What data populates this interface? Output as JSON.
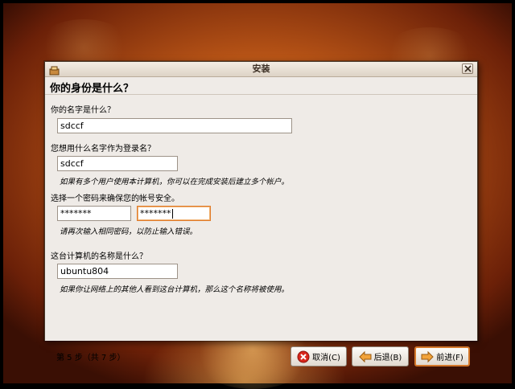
{
  "window": {
    "title": "安装",
    "heading": "你的身份是什么？"
  },
  "form": {
    "name_label": "你的名字是什么？",
    "name_value": "sdccf",
    "login_label": "您想用什么名字作为登录名？",
    "login_value": "sdccf",
    "login_hint": "如果有多个用户使用本计算机，你可以在完成安装后建立多个帐户。",
    "password_label": "选择一个密码来确保您的帐号安全。",
    "password_value": "*******",
    "password_confirm_value": "*******",
    "password_hint": "请再次输入相同密码，以防止输入错误。",
    "computer_label": "这台计算机的名称是什么？",
    "computer_value": "ubuntu804",
    "computer_hint": "如果你让网络上的其他人看到这台计算机，那么这个名称将被使用。"
  },
  "footer": {
    "step_text": "第 5 步（共 7 步）",
    "cancel_label": "取消(C)",
    "back_label": "后退(B)",
    "forward_label": "前进(F)"
  },
  "colors": {
    "accent": "#e07c2b",
    "desktop": "#b65316"
  },
  "icons": {
    "cancel": "cancel-icon",
    "back": "back-arrow-icon",
    "forward": "forward-arrow-icon",
    "close": "close-icon",
    "app": "installer-icon"
  }
}
